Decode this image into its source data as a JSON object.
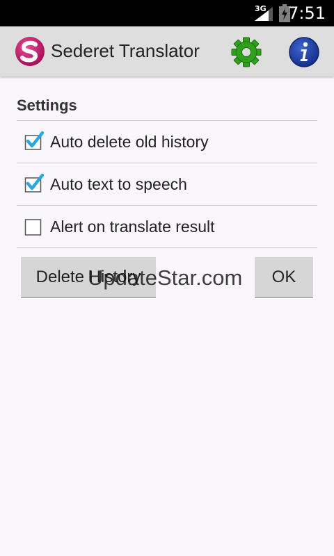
{
  "status_bar": {
    "network": "3G",
    "time": "7:51"
  },
  "action_bar": {
    "title": "Sederet Translator",
    "logo_letter": "S",
    "settings_icon": "gear-icon",
    "info_icon": "info-icon",
    "colors": {
      "logo": "#c4186c",
      "gear": "#2fa01c",
      "info": "#1f3ea3"
    }
  },
  "settings": {
    "section_title": "Settings",
    "options": [
      {
        "label": "Auto delete old history",
        "checked": true
      },
      {
        "label": "Auto text to speech",
        "checked": true
      },
      {
        "label": "Alert on translate result",
        "checked": false
      }
    ]
  },
  "buttons": {
    "delete_label": "Delete History",
    "ok_label": "OK"
  },
  "watermark": "UpdateStar.com",
  "colors": {
    "check": "#2aa7df",
    "background": "#f9f7fb"
  }
}
